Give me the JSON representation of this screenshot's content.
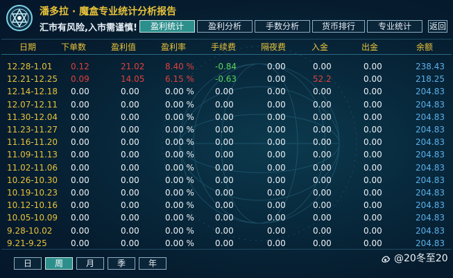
{
  "header": {
    "title": "潘多拉 · 魔盒专业统计分析报告",
    "subtitle": "汇市有风险,入市需谨慎!"
  },
  "tabs": [
    {
      "label": "盈利统计",
      "active": true
    },
    {
      "label": "盈利分析",
      "active": false
    },
    {
      "label": "手数分析",
      "active": false
    },
    {
      "label": "货币排行",
      "active": false
    },
    {
      "label": "专业统计",
      "active": false
    }
  ],
  "back_label": "返回",
  "columns": [
    "日期",
    "下单数",
    "盈利值",
    "盈利率",
    "手续费",
    "隔夜费",
    "入金",
    "出金",
    "余额"
  ],
  "rows": [
    {
      "date": "12.28-1.01",
      "orders": "0.12",
      "profit": "21.02",
      "rate": "8.40 %",
      "commission": "-0.84",
      "swap": "0.00",
      "deposit": "0.00",
      "withdraw": "0.00",
      "balance": "238.43",
      "highlight": true
    },
    {
      "date": "12.21-12.25",
      "orders": "0.09",
      "profit": "14.05",
      "rate": "6.15 %",
      "commission": "-0.63",
      "swap": "0.00",
      "deposit": "52.2",
      "withdraw": "0.00",
      "balance": "218.25",
      "highlight": true
    },
    {
      "date": "12.14-12.18",
      "orders": "0.00",
      "profit": "0.00",
      "rate": "0.00 %",
      "commission": "0.00",
      "swap": "0.00",
      "deposit": "0.00",
      "withdraw": "0.00",
      "balance": "204.83"
    },
    {
      "date": "12.07-12.11",
      "orders": "0.00",
      "profit": "0.00",
      "rate": "0.00 %",
      "commission": "0.00",
      "swap": "0.00",
      "deposit": "0.00",
      "withdraw": "0.00",
      "balance": "204.83"
    },
    {
      "date": "11.30-12.04",
      "orders": "0.00",
      "profit": "0.00",
      "rate": "0.00 %",
      "commission": "0.00",
      "swap": "0.00",
      "deposit": "0.00",
      "withdraw": "0.00",
      "balance": "204.83"
    },
    {
      "date": "11.23-11.27",
      "orders": "0.00",
      "profit": "0.00",
      "rate": "0.00 %",
      "commission": "0.00",
      "swap": "0.00",
      "deposit": "0.00",
      "withdraw": "0.00",
      "balance": "204.83"
    },
    {
      "date": "11.16-11.20",
      "orders": "0.00",
      "profit": "0.00",
      "rate": "0.00 %",
      "commission": "0.00",
      "swap": "0.00",
      "deposit": "0.00",
      "withdraw": "0.00",
      "balance": "204.83"
    },
    {
      "date": "11.09-11.13",
      "orders": "0.00",
      "profit": "0.00",
      "rate": "0.00 %",
      "commission": "0.00",
      "swap": "0.00",
      "deposit": "0.00",
      "withdraw": "0.00",
      "balance": "204.83"
    },
    {
      "date": "11.02-11.06",
      "orders": "0.00",
      "profit": "0.00",
      "rate": "0.00 %",
      "commission": "0.00",
      "swap": "0.00",
      "deposit": "0.00",
      "withdraw": "0.00",
      "balance": "204.83"
    },
    {
      "date": "10.26-10.30",
      "orders": "0.00",
      "profit": "0.00",
      "rate": "0.00 %",
      "commission": "0.00",
      "swap": "0.00",
      "deposit": "0.00",
      "withdraw": "0.00",
      "balance": "204.83"
    },
    {
      "date": "10.19-10.23",
      "orders": "0.00",
      "profit": "0.00",
      "rate": "0.00 %",
      "commission": "0.00",
      "swap": "0.00",
      "deposit": "0.00",
      "withdraw": "0.00",
      "balance": "204.83"
    },
    {
      "date": "10.12-10.16",
      "orders": "0.00",
      "profit": "0.00",
      "rate": "0.00 %",
      "commission": "0.00",
      "swap": "0.00",
      "deposit": "0.00",
      "withdraw": "0.00",
      "balance": "204.83"
    },
    {
      "date": "10.05-10.09",
      "orders": "0.00",
      "profit": "0.00",
      "rate": "0.00 %",
      "commission": "0.00",
      "swap": "0.00",
      "deposit": "0.00",
      "withdraw": "0.00",
      "balance": "204.83"
    },
    {
      "date": "9.28-10.02",
      "orders": "0.00",
      "profit": "0.00",
      "rate": "0.00 %",
      "commission": "0.00",
      "swap": "0.00",
      "deposit": "0.00",
      "withdraw": "0.00",
      "balance": "204.83"
    },
    {
      "date": "9.21-9.25",
      "orders": "0.00",
      "profit": "0.00",
      "rate": "0.00 %",
      "commission": "0.00",
      "swap": "0.00",
      "deposit": "0.00",
      "withdraw": "0.00",
      "balance": "204.83"
    }
  ],
  "periods": [
    {
      "label": "日",
      "active": false
    },
    {
      "label": "周",
      "active": true
    },
    {
      "label": "月",
      "active": false
    },
    {
      "label": "季",
      "active": false
    },
    {
      "label": "年",
      "active": false
    }
  ],
  "credit": {
    "icon": "weibo-icon",
    "text": "@20冬至20"
  },
  "colors": {
    "gold": "#e8c23a",
    "red": "#e0403a",
    "green": "#5cd75c",
    "blue": "#5ab0ea",
    "teal_active": "#2d8f8c"
  }
}
